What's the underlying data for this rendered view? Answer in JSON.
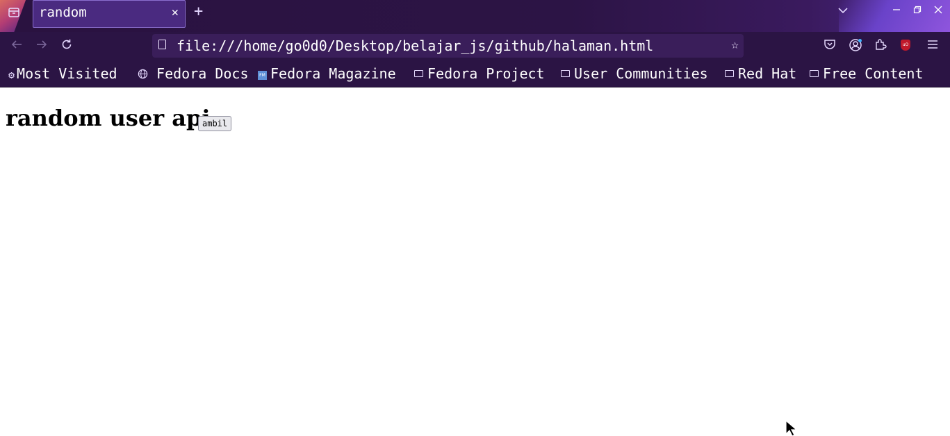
{
  "tabs": [
    {
      "title": "random",
      "active": true
    }
  ],
  "tabbar": {
    "new_tab_icon": "plus-icon",
    "list_all_tabs_icon": "chevron-down-icon"
  },
  "navbar": {
    "url": "file:///home/go0d0/Desktop/belajar_js/github/halaman.html",
    "back_icon": "arrow-left-icon",
    "forward_icon": "arrow-right-icon",
    "reload_icon": "reload-icon"
  },
  "bookmarks": [
    {
      "label": "Most Visited",
      "icon": "gear-icon"
    },
    {
      "label": "Fedora Docs",
      "icon": "globe-icon"
    },
    {
      "label": "Fedora Magazine",
      "icon": "fm-icon"
    },
    {
      "label": "Fedora Project",
      "icon": "folder-icon"
    },
    {
      "label": "User Communities",
      "icon": "folder-icon"
    },
    {
      "label": "Red Hat",
      "icon": "folder-icon"
    },
    {
      "label": "Free Content",
      "icon": "folder-icon"
    }
  ],
  "page": {
    "heading": "random user api",
    "button_label": "ambil"
  },
  "colors": {
    "chrome_bg": "#2b1444",
    "tab_active_border": "#8c6fd0",
    "accent": "#6e46d2",
    "ublock_red": "#c0192b"
  }
}
